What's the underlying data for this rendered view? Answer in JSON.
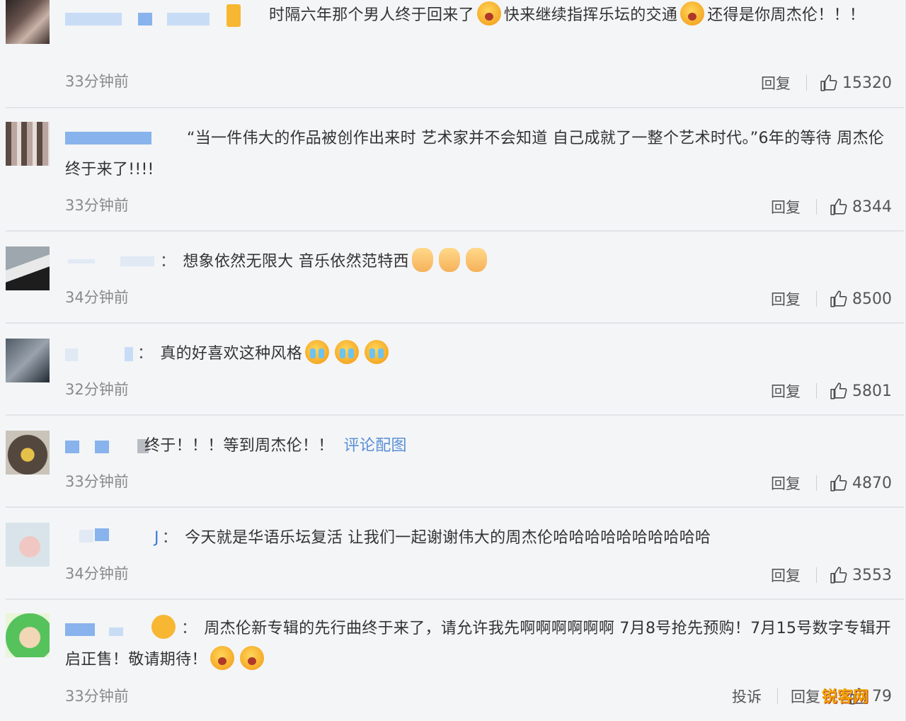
{
  "comments": [
    {
      "content_parts": [
        "时隔六年那个男人终于回来了",
        "快来继续指挥乐坛的交通",
        "还得是你周杰伦！！！"
      ],
      "time": "33分钟前",
      "reply": "回复",
      "likes": "15320"
    },
    {
      "content": "“当一件伟大的作品被创作出来时 艺术家并不会知道 自己成就了一整个艺术时代。”6年的等待 周杰伦终于来了!!!!",
      "time": "33分钟前",
      "reply": "回复",
      "likes": "8344"
    },
    {
      "colon": "：",
      "content": "想象依然无限大 音乐依然范特西",
      "time": "34分钟前",
      "reply": "回复",
      "likes": "8500"
    },
    {
      "colon": "：",
      "content": "真的好喜欢这种风格",
      "time": "32分钟前",
      "reply": "回复",
      "likes": "5801"
    },
    {
      "content": "终于！！！等到周杰伦！！",
      "link": "评论配图",
      "time": "33分钟前",
      "reply": "回复",
      "likes": "4870"
    },
    {
      "name_tail": "J",
      "colon": "：",
      "content": "今天就是华语乐坛复活 让我们一起谢谢伟大的周杰伦哈哈哈哈哈哈哈哈哈哈",
      "time": "34分钟前",
      "reply": "回复",
      "likes": "3553"
    },
    {
      "colon": "：",
      "content": "周杰伦新专辑的先行曲终于来了，请允许我先啊啊啊啊啊啊 7月8号抢先预购！7月15号数字专辑开启正售！敬请期待！",
      "time": "33分钟前",
      "report": "投诉",
      "reply": "回复",
      "likes": "79"
    }
  ],
  "watermark": "锐客网",
  "colors": {
    "link": "#5a8fd6",
    "meta": "#8a8a8a",
    "text": "#333333"
  }
}
